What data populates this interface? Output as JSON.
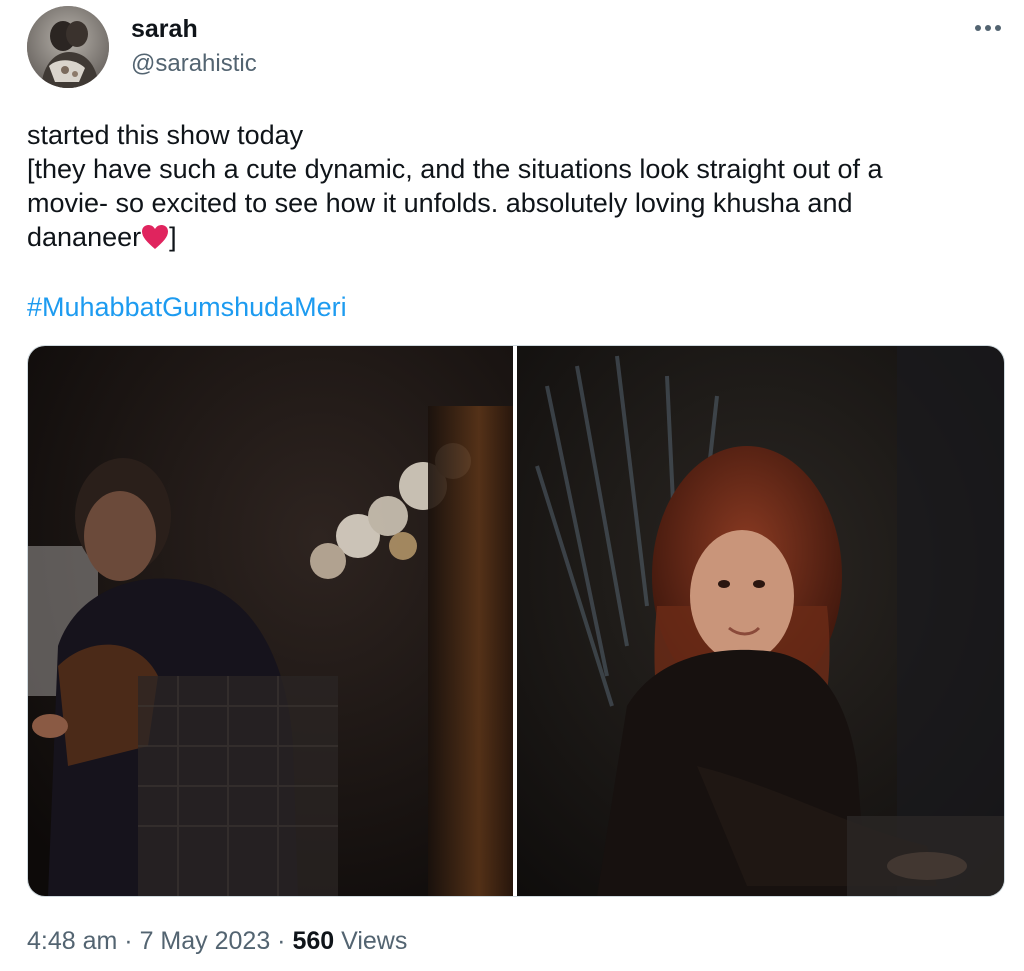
{
  "author": {
    "display_name": "sarah",
    "handle": "@sarahistic"
  },
  "tweet": {
    "lines": [
      "started this show today",
      "[they have such a cute dynamic, and the situations look straight out of a",
      "movie- so excited to see how it unfolds. absolutely loving khusha and",
      "dananeer"
    ],
    "line4_suffix": "]",
    "hashtag": "#MuhabbatGumshudaMeri"
  },
  "media": {
    "count": 2
  },
  "meta": {
    "time": "4:48 am",
    "separator": "·",
    "date": "7 May 2023",
    "views_count": "560",
    "views_label": "Views"
  },
  "colors": {
    "link": "#1d9bf0",
    "secondary_text": "#536471",
    "primary_text": "#0f1419",
    "heart": "#e0245e"
  },
  "icons": {
    "more": "more-horizontal-icon",
    "heart": "red-heart-emoji"
  }
}
